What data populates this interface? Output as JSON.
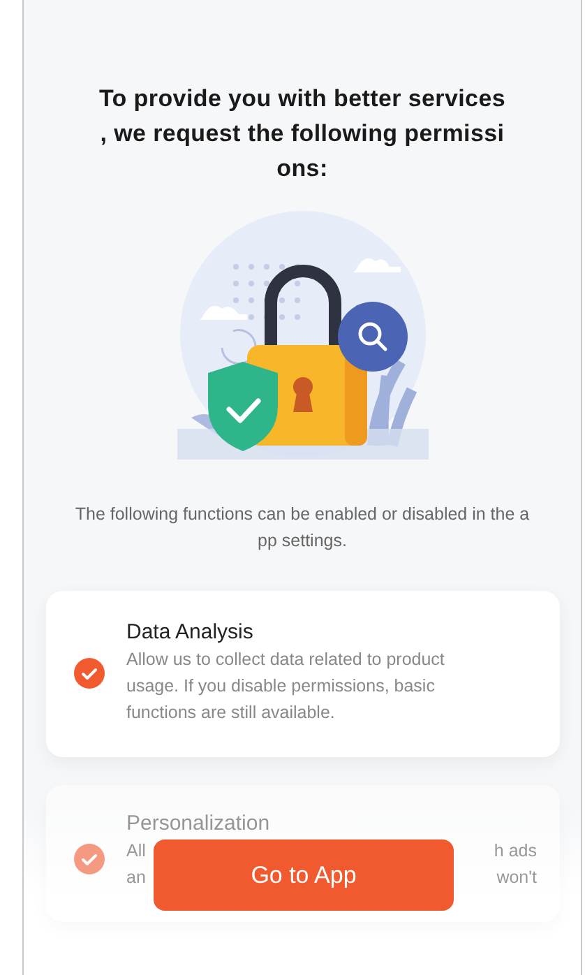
{
  "title_lines": [
    "To provide you with better services",
    ", we request the following permissi",
    "ons:"
  ],
  "subtitle_lines": [
    "The following functions can be enabled or disabled in the a",
    "pp settings."
  ],
  "permissions": [
    {
      "title": "Data Analysis",
      "checked": true,
      "faded": false,
      "description": "Allow us to collect data related to product usage. If you disable permissions, basic functions are still available."
    },
    {
      "title": "Personalization",
      "checked": true,
      "faded": true,
      "fragments": [
        {
          "left": "All",
          "right": "h ads"
        },
        {
          "left": "an",
          "right": "won't"
        }
      ]
    }
  ],
  "button": {
    "label": "Go to App"
  }
}
